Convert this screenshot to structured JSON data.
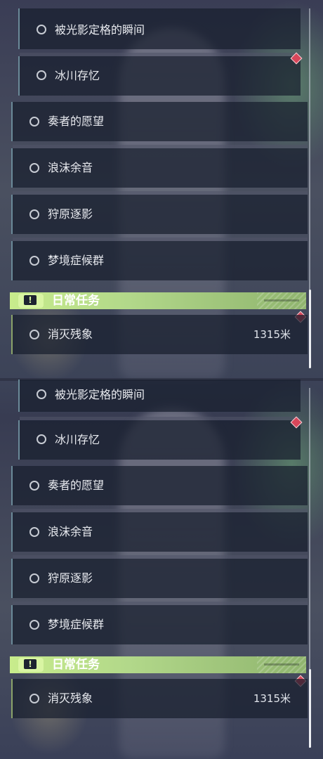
{
  "panels": [
    {
      "quests": [
        {
          "label": "被光影定格的瞬间"
        },
        {
          "label": "冰川存忆"
        },
        {
          "label": "奏者的愿望"
        },
        {
          "label": "浪沫余音"
        },
        {
          "label": "狩原逐影"
        },
        {
          "label": "梦境症候群"
        }
      ],
      "daily": {
        "header_title": "日常任务",
        "header_icon": "!",
        "item_label": "消灭残象",
        "distance": "1315米"
      }
    },
    {
      "quests": [
        {
          "label": "被光影定格的瞬间"
        },
        {
          "label": "冰川存忆"
        },
        {
          "label": "奏者的愿望"
        },
        {
          "label": "浪沫余音"
        },
        {
          "label": "狩原逐影"
        },
        {
          "label": "梦境症候群"
        }
      ],
      "daily": {
        "header_title": "日常任务",
        "header_icon": "!",
        "item_label": "消灭残象",
        "distance": "1315米"
      }
    }
  ],
  "colors": {
    "daily_header": "#c8ec8c",
    "marker": "#d8465a",
    "item_bg": "#181e2e"
  }
}
